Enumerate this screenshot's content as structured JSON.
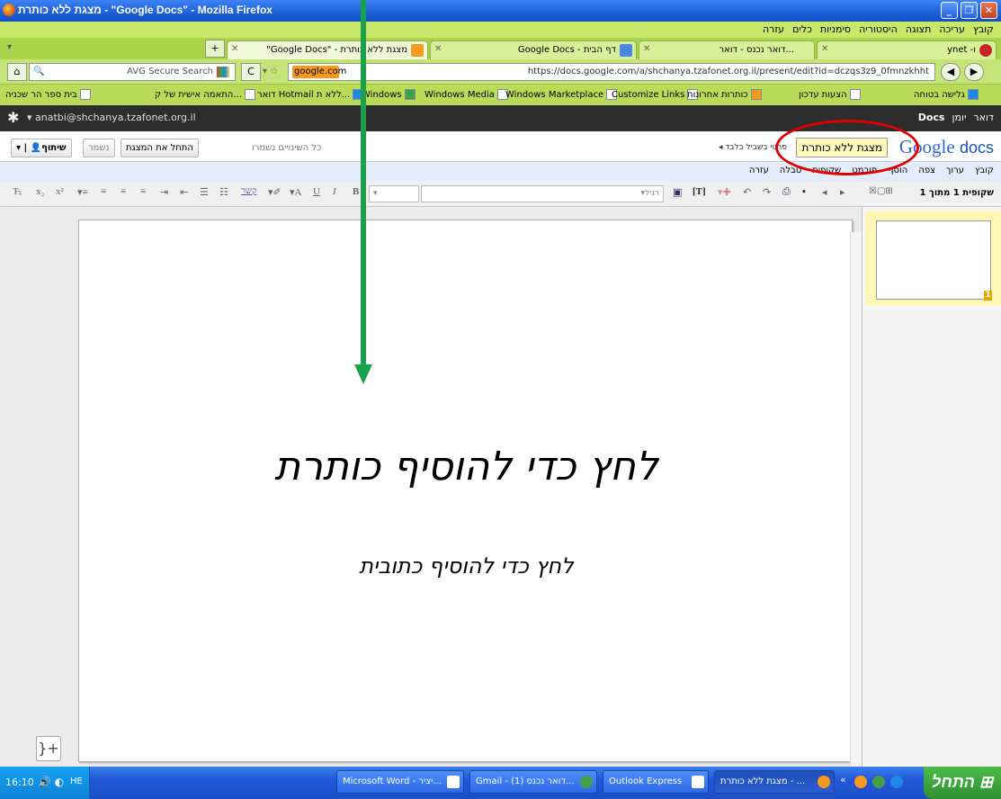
{
  "window": {
    "title": "מצגת ללא כותרת - \"Google Docs\" - Mozilla Firefox"
  },
  "menubar": {
    "items": [
      "קובץ",
      "עריכה",
      "תצוגה",
      "היסטוריה",
      "סימניות",
      "כלים",
      "עזרה"
    ]
  },
  "tabs": [
    {
      "label": "\"Google Docs\" - מצגת ללא כותרת",
      "active": true
    },
    {
      "label": "Google Docs - דף הבית",
      "active": false
    },
    {
      "label": "דואר נכנס - דואר...",
      "active": false
    },
    {
      "label": "ynet -ו",
      "active": false
    }
  ],
  "navbar": {
    "url": "https://docs.google.com/a/shchanya.tzafonet.org.il/present/edit?id=dczqs3z9_0fmnzkhht",
    "search_engine": "google.com",
    "avg_search": "AVG Secure Search"
  },
  "bookmarks": [
    "גלישה בטוחה",
    "הצעות עדכון",
    "כותרות אחרונות",
    "Customize Links",
    "Windows Marketplace",
    "Windows Media",
    "Windows",
    "דואר Hotmail ללא ת...",
    "התאמה אישית של ק...",
    "בית ספר הר שכניה"
  ],
  "googlebar": {
    "account": "anatbi@shchanya.tzafonet.org.il",
    "links": [
      "Docs",
      "יומן",
      "דואר"
    ]
  },
  "docs": {
    "logo_google": "Google",
    "logo_docs": "docs",
    "title": "מצגת ללא כותרת",
    "owner": "פרטי בשביל בלבד",
    "save_status": "כל השינויים נשמרו",
    "start_presentation": "התחל את המצגת",
    "saved": "נשמר",
    "share": "שיתוף"
  },
  "docs_menu": [
    "קובץ",
    "ערוך",
    "צפה",
    "הוסף",
    "פורמט",
    "שקופית",
    "טבלה",
    "עזרה"
  ],
  "toolbar": {
    "slide_counter": "שקופית 1 מתוך 1",
    "font_select": "רגיל",
    "link_label": "קשר"
  },
  "slide": {
    "title_placeholder": "לחץ כדי להוסיף כותרת",
    "subtitle_placeholder": "לחץ כדי להוסיף כתובית"
  },
  "filmstrip": {
    "thumb_number": "1"
  },
  "taskbar": {
    "start": "התחל",
    "clock": "16:10",
    "lang": "HE",
    "tasks": [
      "מצגת ללא כותרת - ...",
      "Outlook Express",
      "Gmail - דואר נכנס (1)...",
      "Microsoft Word - יציר..."
    ]
  },
  "colors": {
    "annotation_arrow": "#1aa24a",
    "annotation_ellipse": "#e00000",
    "firefox_theme": "#b8dc58"
  }
}
